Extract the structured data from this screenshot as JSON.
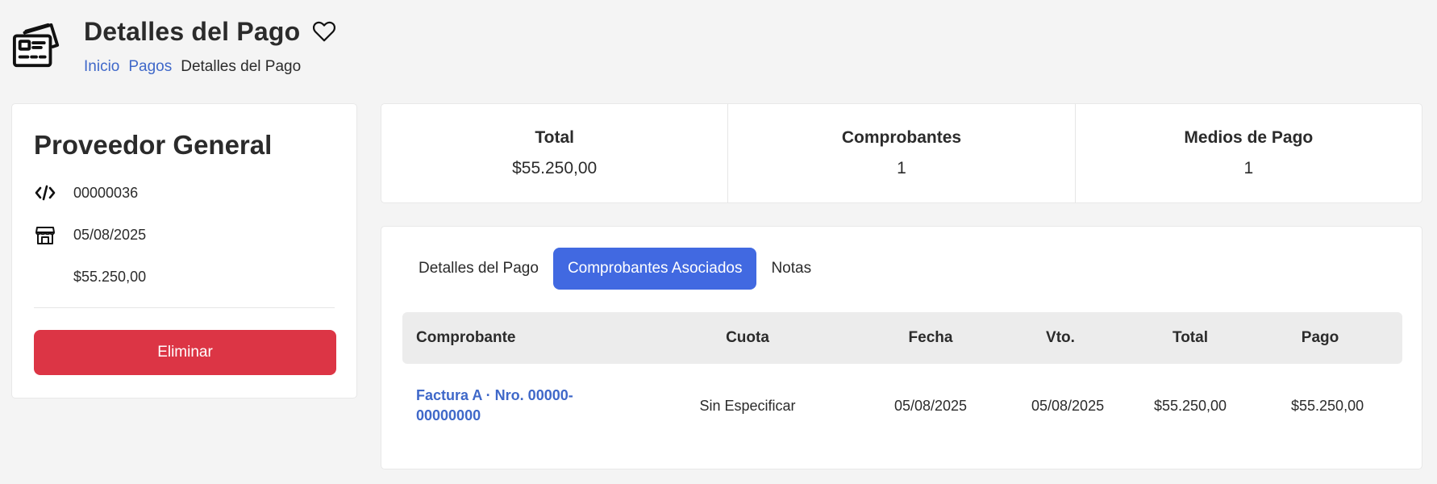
{
  "header": {
    "title": "Detalles del Pago",
    "icon": "credit-cards-icon",
    "favorite_icon": "heart-outline-icon",
    "breadcrumb": [
      {
        "label": "Inicio"
      },
      {
        "label": "Pagos"
      },
      {
        "label": "Detalles del Pago"
      }
    ]
  },
  "provider": {
    "name": "Proveedor General",
    "code": "00000036",
    "date": "05/08/2025",
    "amount": "$55.250,00",
    "code_icon": "code-icon",
    "date_icon": "store-icon",
    "delete_label": "Eliminar",
    "delete_color": "#dc3545"
  },
  "stats": [
    {
      "label": "Total",
      "value": "$55.250,00"
    },
    {
      "label": "Comprobantes",
      "value": "1"
    },
    {
      "label": "Medios de Pago",
      "value": "1"
    }
  ],
  "tabs": [
    {
      "label": "Detalles del Pago",
      "active": false
    },
    {
      "label": "Comprobantes Asociados",
      "active": true
    },
    {
      "label": "Notas",
      "active": false
    }
  ],
  "accent_color": "#4169e1",
  "table": {
    "columns": [
      "Comprobante",
      "Cuota",
      "Fecha",
      "Vto.",
      "Total",
      "Pago"
    ],
    "rows": [
      {
        "comprobante": "Factura A · Nro. 00000-00000000",
        "cuota": "Sin Especificar",
        "fecha": "05/08/2025",
        "vto": "05/08/2025",
        "total": "$55.250,00",
        "pago": "$55.250,00"
      }
    ]
  }
}
